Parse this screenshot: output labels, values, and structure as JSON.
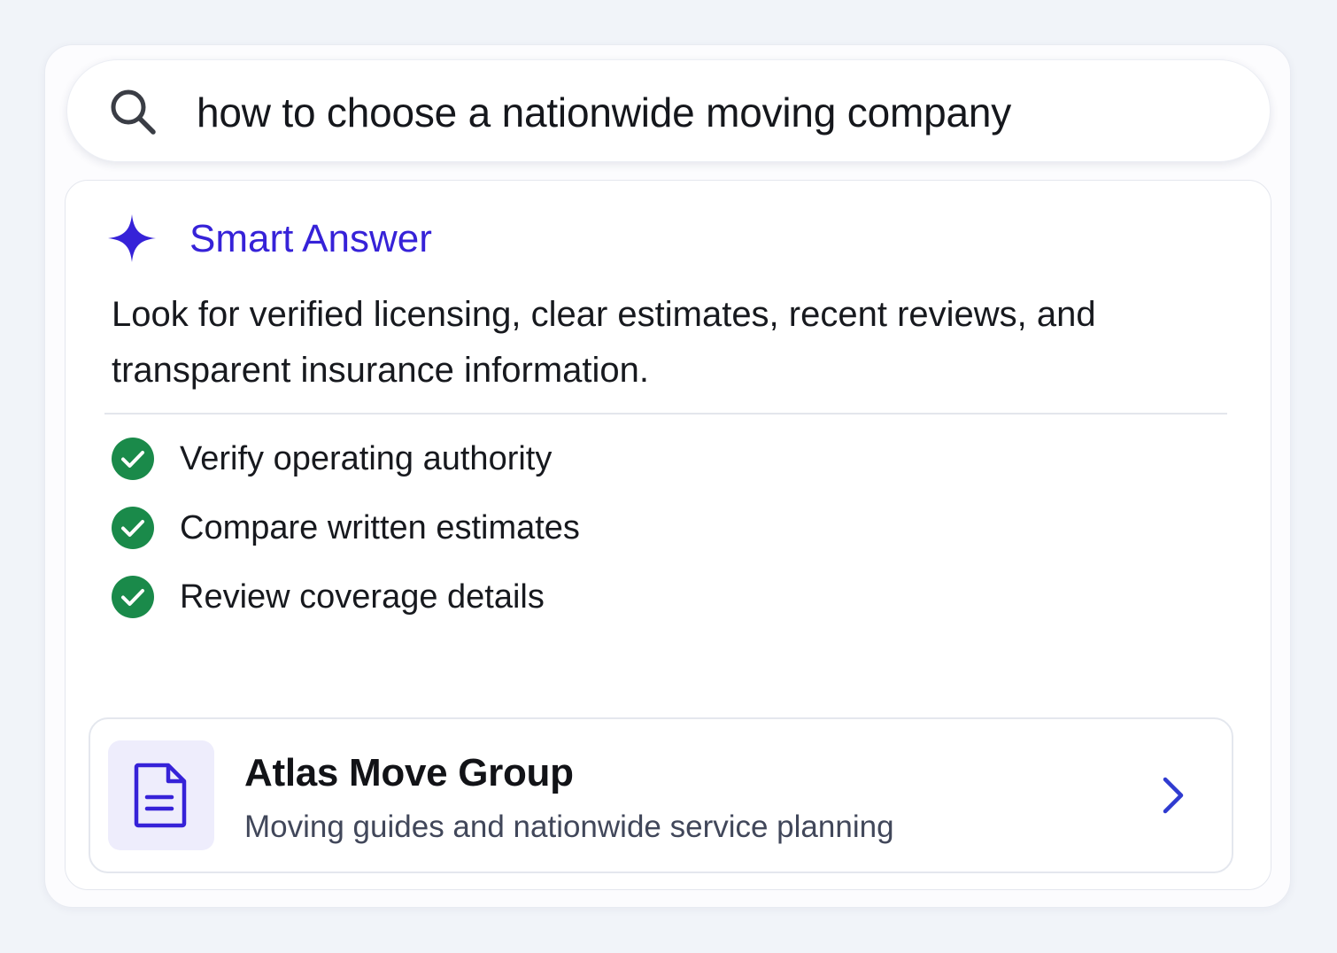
{
  "search": {
    "query": "how to choose a nationwide moving company",
    "icon": "search-icon"
  },
  "answer": {
    "icon": "sparkle-icon",
    "title": "Smart Answer",
    "summary": "Look for verified licensing, clear estimates, recent reviews, and transparent insurance information.",
    "checklist": [
      {
        "label": "Verify operating authority",
        "icon": "check-circle-icon"
      },
      {
        "label": "Compare written estimates",
        "icon": "check-circle-icon"
      },
      {
        "label": "Review coverage details",
        "icon": "check-circle-icon"
      }
    ]
  },
  "source": {
    "icon": "document-icon",
    "title": "Atlas Move Group",
    "description": "Moving guides and nationwide service planning",
    "action_icon": "chevron-right-icon"
  },
  "colors": {
    "page_background": "#f1f4f9",
    "accent": "#3622d8",
    "check_green": "#1a8a4a",
    "doc_tile": "#eeedfc",
    "text_primary": "#17191e",
    "text_secondary": "#41475a"
  }
}
